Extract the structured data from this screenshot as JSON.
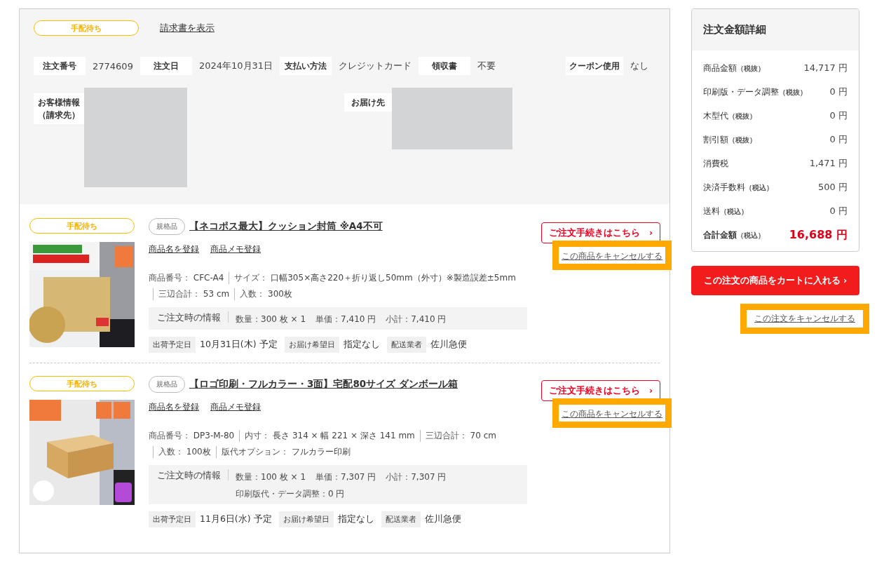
{
  "order": {
    "status": "手配待ち",
    "invoice_link": "請求書を表示",
    "fields": [
      {
        "label": "注文番号",
        "value": "2774609"
      },
      {
        "label": "注文日",
        "value": "2024年10月31日"
      },
      {
        "label": "支払い方法",
        "value": "クレジットカード"
      },
      {
        "label": "領収書",
        "value": "不要"
      }
    ],
    "coupon": {
      "label": "クーポン使用",
      "value": "なし"
    },
    "customer_label": "お客様情報（請求先）",
    "delivery_label": "お届け先"
  },
  "products": [
    {
      "status": "手配待ち",
      "tag": "規格品",
      "title": "【ネコポス最大】クッション封筒 ※A4不可",
      "links": [
        "商品名を登録",
        "商品メモ登録"
      ],
      "specs": [
        [
          {
            "label": "商品番号：",
            "value": "CFC-A4"
          },
          {
            "label": "サイズ：",
            "value": "口幅305×高さ220＋折り返し50mm（外寸）※製造誤差±5mm"
          }
        ],
        [
          {
            "label": "三辺合計：",
            "value": "53 cm"
          },
          {
            "label": "入数：",
            "value": "300枚"
          }
        ]
      ],
      "order_info": {
        "title": "ご注文時の情報",
        "items": [
          {
            "label": "数量：",
            "value": "300 枚 × 1"
          },
          {
            "label": "単価：",
            "value": "7,410 円"
          },
          {
            "label": "小計：",
            "value": "7,410 円"
          }
        ]
      },
      "shipping": [
        {
          "label": "出荷予定日",
          "value": "10月31日(木) 予定"
        },
        {
          "label": "お届け希望日",
          "value": "指定なし"
        },
        {
          "label": "配送業者",
          "value": "佐川急便"
        }
      ],
      "order_button": "ご注文手続きはこちら",
      "arrow": "›",
      "cancel": "この商品をキャンセルする",
      "highlighted": true,
      "image": {
        "kind": "picture"
      }
    },
    {
      "status": "手配待ち",
      "tag": "規格品",
      "title": "【ロゴ印刷・フルカラー・3面】宅配80サイズ ダンボール箱",
      "links": [
        "商品名を登録",
        "商品メモ登録"
      ],
      "specs": [
        [
          {
            "label": "商品番号：",
            "value": "DP3-M-80"
          },
          {
            "label": "内寸：",
            "value": "長さ 314 × 幅 221 × 深さ 141 mm"
          },
          {
            "label": "三辺合計：",
            "value": "70 cm"
          }
        ],
        [
          {
            "label": "入数：",
            "value": "100枚"
          },
          {
            "label": "版代オプション：",
            "value": "フルカラー印刷"
          }
        ]
      ],
      "order_info": {
        "title": "ご注文時の情報",
        "items": [
          {
            "label": "数量：",
            "value": "100 枚 × 1"
          },
          {
            "label": "単価：",
            "value": "7,307 円"
          },
          {
            "label": "小計：",
            "value": "7,307 円"
          }
        ],
        "extra": [
          {
            "label": "印刷版代・データ調整：",
            "value": "0 円"
          }
        ]
      },
      "shipping": [
        {
          "label": "出荷予定日",
          "value": "11月6日(水) 予定"
        },
        {
          "label": "お届け希望日",
          "value": "指定なし"
        },
        {
          "label": "配送業者",
          "value": "佐川急便"
        }
      ],
      "order_button": "ご注文手続きはこちら",
      "arrow": "›",
      "cancel": "この商品をキャンセルする",
      "highlighted": true,
      "image": {
        "kind": "picture"
      }
    }
  ],
  "summary": {
    "title": "注文金額詳細",
    "rows": [
      {
        "kind": "normal",
        "label": "商品金額",
        "note": "（税抜）",
        "value": "14,717 円"
      },
      {
        "kind": "normal",
        "label": "印刷版・データ調整",
        "note": "（税抜）",
        "value": "0 円"
      },
      {
        "kind": "normal",
        "label": "木型代",
        "note": "（税抜）",
        "value": "0 円"
      },
      {
        "kind": "normal",
        "label": "割引額",
        "note": "（税抜）",
        "value": "0 円"
      },
      {
        "kind": "normal",
        "label": "消費税",
        "value": "1,471 円"
      },
      {
        "kind": "normal",
        "label": "決済手数料",
        "note": "（税込）",
        "value": "500 円"
      },
      {
        "kind": "normal",
        "label": "送料",
        "note": "（税込）",
        "value": "0 円"
      },
      {
        "kind": "total",
        "label": "合計金額",
        "note": "（税込）",
        "value": "16,688 円"
      }
    ]
  },
  "cart_button": {
    "label": "この注文の商品をカートに入れる",
    "arrow": "›"
  },
  "cancel_order": {
    "label": "この注文をキャンセルする",
    "highlighted": true
  }
}
